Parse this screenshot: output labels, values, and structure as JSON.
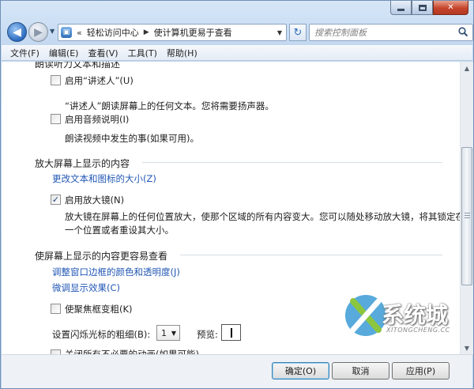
{
  "window": {
    "caption_icons": [
      "minimize-icon",
      "maximize-icon",
      "close-icon"
    ]
  },
  "nav": {
    "address_prefix": "«",
    "breadcrumbs": [
      "轻松访问中心",
      "使计算机更易于查看"
    ],
    "search_placeholder": "搜索控制面板"
  },
  "menu": [
    "文件(F)",
    "编辑(E)",
    "查看(V)",
    "工具(T)",
    "帮助(H)"
  ],
  "sections": {
    "narrator": {
      "title": "朗读听力文本和描述",
      "checkbox1": {
        "label": "启用“讲述人”(U)",
        "checked": false
      },
      "desc1": "“讲述人”朗读屏幕上的任何文本。您将需要扬声器。",
      "checkbox2": {
        "label": "启用音频说明(I)",
        "checked": false
      },
      "desc2": "朗读视频中发生的事(如果可用)。"
    },
    "magnify": {
      "title": "放大屏幕上显示的内容",
      "link": "更改文本和图标的大小(Z)",
      "checkbox": {
        "label": "启用放大镜(N)",
        "checked": true,
        "mark": "✓"
      },
      "desc_line1": "放大镜在屏幕上的任何位置放大，使那个区域的所有内容变大。您可以随处移动放大镜，将其锁定在",
      "desc_line2": "一个位置或者重设其大小。"
    },
    "easier": {
      "title": "使屏幕上显示的内容更容易查看",
      "link1": "调整窗口边框的颜色和透明度(J)",
      "link2": "微调显示效果(C)",
      "checkbox": {
        "label": "使聚焦框变粗(K)",
        "checked": false
      },
      "cursor_label": "设置闪烁光标的粗细(B):",
      "cursor_value": "1",
      "preview_label": "预览:",
      "partial_text": "关闭所有不必要的动画(如果可能)"
    }
  },
  "buttons": {
    "ok": "确定(O)",
    "cancel": "取消",
    "apply": "应用(P)"
  },
  "watermark": {
    "text": "系统城",
    "url": "XITONGCHENG.CC",
    "colors": {
      "primary": "#3a9bd5",
      "accent": "#8cc63f"
    }
  },
  "colors": {
    "link": "#2257b5",
    "chrome": "#c2d8f0",
    "close_button": "#c4442b"
  }
}
